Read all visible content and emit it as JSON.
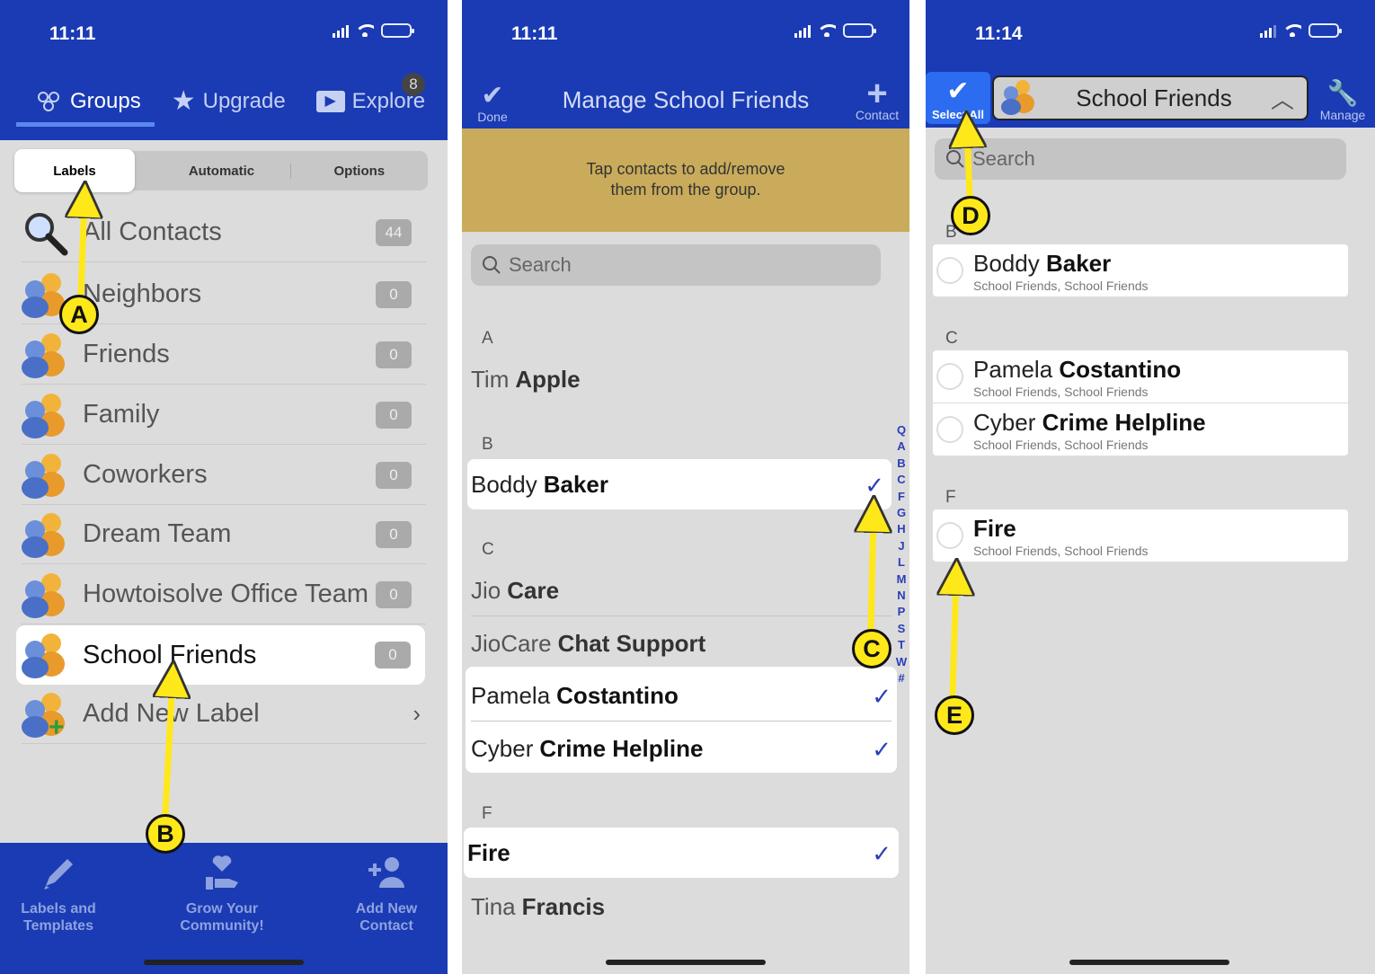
{
  "panel1": {
    "status_time": "11:11",
    "tabs": [
      {
        "label": "Groups"
      },
      {
        "label": "Upgrade"
      },
      {
        "label": "Explore"
      }
    ],
    "tab_badge": "8",
    "segments": [
      "Labels",
      "Automatic",
      "Options"
    ],
    "labels": [
      {
        "name": "All Contacts",
        "count": "44"
      },
      {
        "name": "Neighbors",
        "count": "0"
      },
      {
        "name": "Friends",
        "count": "0"
      },
      {
        "name": "Family",
        "count": "0"
      },
      {
        "name": "Coworkers",
        "count": "0"
      },
      {
        "name": "Dream Team",
        "count": "0"
      },
      {
        "name": "Howtoisolve Office Team",
        "count": "0"
      },
      {
        "name": "School Friends",
        "count": "0"
      },
      {
        "name": "Add New Label",
        "count": ""
      }
    ],
    "bottom": [
      {
        "line1": "Labels and",
        "line2": "Templates"
      },
      {
        "line1": "Grow Your",
        "line2": "Community!"
      },
      {
        "line1": "Add New",
        "line2": "Contact"
      }
    ]
  },
  "panel2": {
    "status_time": "11:11",
    "done_label": "Done",
    "title": "Manage School Friends",
    "contact_label": "Contact",
    "banner_line1": "Tap contacts to add/remove",
    "banner_line2": "them from the group.",
    "search_placeholder": "Search",
    "sections": [
      "A",
      "B",
      "C",
      "F"
    ],
    "contacts": [
      {
        "first": "Tim",
        "last": "Apple"
      },
      {
        "first": "Boddy",
        "last": "Baker"
      },
      {
        "first": "Jio",
        "last": "Care"
      },
      {
        "first": "JioCare",
        "last": "Chat Support"
      },
      {
        "first": "Pamela",
        "last": "Costantino"
      },
      {
        "first": "Cyber",
        "last": "Crime Helpline"
      },
      {
        "first": "",
        "last": "Fire"
      },
      {
        "first": "Tina",
        "last": "Francis"
      }
    ],
    "index": [
      "Q",
      "A",
      "B",
      "C",
      "F",
      "G",
      "H",
      "J",
      "L",
      "M",
      "N",
      "P",
      "S",
      "T",
      "W",
      "#"
    ]
  },
  "panel3": {
    "status_time": "11:14",
    "select_all_label": "Select All",
    "group_name": "School Friends",
    "manage_label": "Manage",
    "search_placeholder": "Search",
    "sections": [
      "B",
      "C",
      "F"
    ],
    "contacts": [
      {
        "first": "Boddy",
        "last": "Baker",
        "sub": "School Friends, School Friends"
      },
      {
        "first": "Pamela",
        "last": "Costantino",
        "sub": "School Friends, School Friends"
      },
      {
        "first": "Cyber",
        "last": "Crime Helpline",
        "sub": "School Friends, School Friends"
      },
      {
        "first": "",
        "last": "Fire",
        "sub": "School Friends, School Friends"
      }
    ]
  },
  "annotations": [
    "A",
    "B",
    "C",
    "D",
    "E"
  ],
  "colors": {
    "nav_blue": "#1a3bb3",
    "arrow_yellow": "#ffe81a",
    "check_blue": "#2a3eb8",
    "banner": "#c9ab5b"
  }
}
